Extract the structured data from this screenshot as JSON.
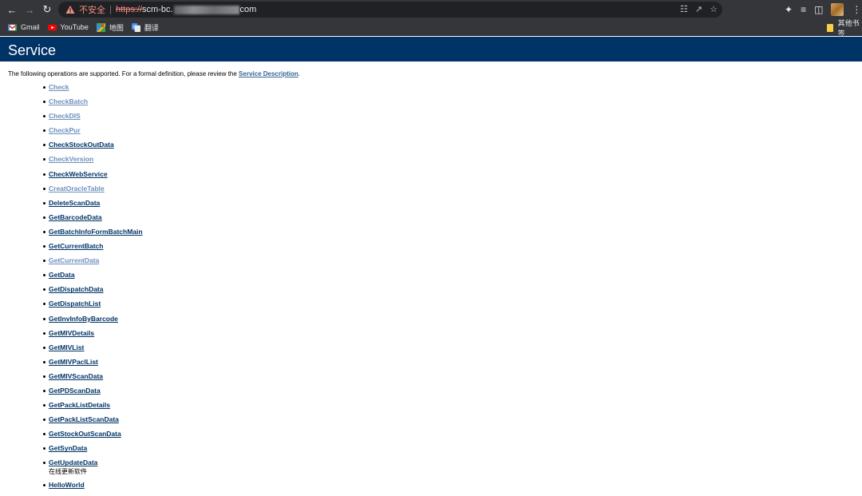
{
  "browser": {
    "insecure_label": "不安全",
    "url_scheme": "https://",
    "url_host_start": "scm-bc.",
    "url_host_end": "com"
  },
  "bookmarks": [
    {
      "label": "Gmail",
      "icon": "gmail-icon"
    },
    {
      "label": "YouTube",
      "icon": "youtube-icon"
    },
    {
      "label": "地图",
      "icon": "maps-icon"
    },
    {
      "label": "翻译",
      "icon": "translate-icon"
    }
  ],
  "other_bookmarks_label": "其他书签",
  "page": {
    "title": "Service",
    "intro_text": "The following operations are supported. For a formal definition, please review the ",
    "intro_link": "Service Description",
    "intro_end": "."
  },
  "operations": [
    {
      "name": "Check",
      "visited": true
    },
    {
      "name": "CheckBatch",
      "visited": true
    },
    {
      "name": "CheckDIS",
      "visited": true
    },
    {
      "name": "CheckPur",
      "visited": true
    },
    {
      "name": "CheckStockOutData",
      "visited": false
    },
    {
      "name": "CheckVersion",
      "visited": true
    },
    {
      "name": "CheckWebService",
      "visited": false
    },
    {
      "name": "CreatOracleTable",
      "visited": true
    },
    {
      "name": "DeleteScanData",
      "visited": false
    },
    {
      "name": "GetBarcodeData",
      "visited": false
    },
    {
      "name": "GetBatchInfoFormBatchMain",
      "visited": false
    },
    {
      "name": "GetCurrentBatch",
      "visited": false
    },
    {
      "name": "GetCurrentData",
      "visited": true
    },
    {
      "name": "GetData",
      "visited": false
    },
    {
      "name": "GetDispatchData",
      "visited": false
    },
    {
      "name": "GetDispatchList",
      "visited": false
    },
    {
      "name": "GetInvInfoByBarcode",
      "visited": false
    },
    {
      "name": "GetMIVDetails",
      "visited": false
    },
    {
      "name": "GetMIVList",
      "visited": false
    },
    {
      "name": "GetMIVPaclList",
      "visited": false
    },
    {
      "name": "GetMIVScanData",
      "visited": false
    },
    {
      "name": "GetPDScanData",
      "visited": false
    },
    {
      "name": "GetPackListDetails",
      "visited": false
    },
    {
      "name": "GetPackListScanData",
      "visited": false
    },
    {
      "name": "GetStockOutScanData",
      "visited": false
    },
    {
      "name": "GetSynData",
      "visited": false
    },
    {
      "name": "GetUpdateData",
      "visited": false,
      "description": "在线更新软件"
    },
    {
      "name": "HelloWorld",
      "visited": false
    }
  ]
}
